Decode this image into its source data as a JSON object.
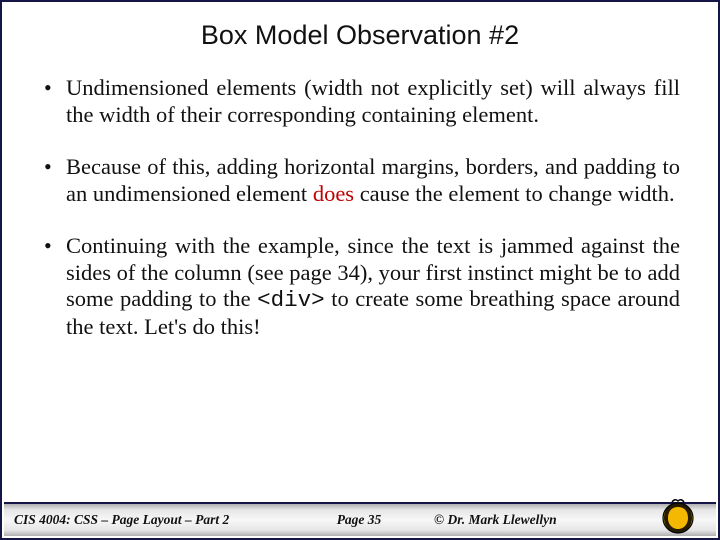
{
  "title": "Box Model Observation #2",
  "bullets": {
    "b1": "Undimensioned elements (width not explicitly set)  will always fill the width of their corresponding containing element.",
    "b2a": "Because of this, adding horizontal margins, borders, and padding to an undimensioned element ",
    "b2_red": "does",
    "b2b": " cause the element to change width.",
    "b3a": "Continuing with the example, since the text is jammed against the sides of the column (see page 34), your first instinct might be to add some padding to the ",
    "b3_code": "<div>",
    "b3b": "  to create some breathing space around the text.  Let's do this!"
  },
  "footer": {
    "course": "CIS 4004: CSS – Page Layout – Part 2",
    "page": "Page 35",
    "author": "© Dr. Mark Llewellyn"
  }
}
